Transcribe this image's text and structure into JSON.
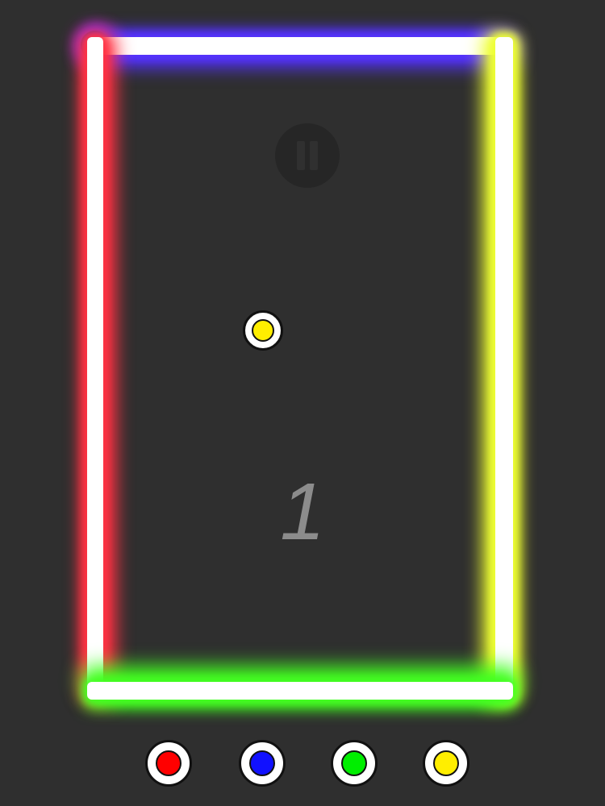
{
  "score": "1",
  "walls": {
    "top_color": "#5533ff",
    "left_color": "#ff3344",
    "right_color": "#eeff33",
    "bottom_color": "#44ff22"
  },
  "ball": {
    "color": "#ffee00",
    "color_name": "yellow"
  },
  "pause_icon": "pause-icon",
  "color_buttons": [
    {
      "name": "red",
      "color": "#ff0000"
    },
    {
      "name": "blue",
      "color": "#1111ff"
    },
    {
      "name": "green",
      "color": "#00ee00"
    },
    {
      "name": "yellow",
      "color": "#ffee00"
    }
  ]
}
